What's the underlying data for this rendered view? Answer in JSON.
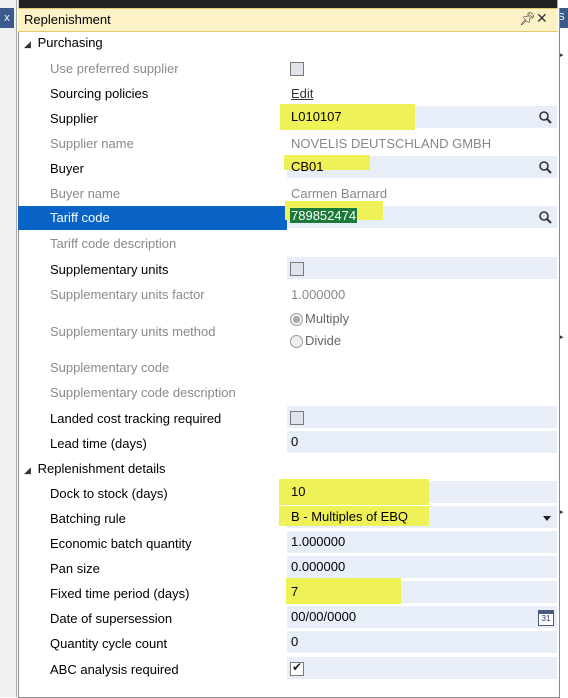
{
  "panel": {
    "title": "Replenishment",
    "pin_icon": "pin-icon",
    "close_icon": "close-icon"
  },
  "left_tab": "x",
  "right_tab": "S",
  "sections": {
    "purchasing": "Purchasing",
    "replenishment_details": "Replenishment details"
  },
  "fields": {
    "use_preferred_supplier": {
      "label": "Use preferred supplier",
      "checked": false
    },
    "sourcing_policies": {
      "label": "Sourcing policies",
      "value": "Edit"
    },
    "supplier": {
      "label": "Supplier",
      "value": "L010107"
    },
    "supplier_name": {
      "label": "Supplier name",
      "value": "NOVELIS DEUTSCHLAND GMBH"
    },
    "buyer": {
      "label": "Buyer",
      "value": "CB01"
    },
    "buyer_name": {
      "label": "Buyer name",
      "value": "Carmen Barnard"
    },
    "tariff_code": {
      "label": "Tariff code",
      "value": "789852474"
    },
    "tariff_code_description": {
      "label": "Tariff code description",
      "value": ""
    },
    "supplementary_units": {
      "label": "Supplementary units",
      "checked": false
    },
    "supplementary_units_factor": {
      "label": "Supplementary units factor",
      "value": "1.000000"
    },
    "supplementary_units_method": {
      "label": "Supplementary units method",
      "options": [
        "Multiply",
        "Divide"
      ],
      "selected": "Multiply"
    },
    "supplementary_code": {
      "label": "Supplementary code",
      "value": ""
    },
    "supplementary_code_description": {
      "label": "Supplementary code description",
      "value": ""
    },
    "landed_cost_tracking_required": {
      "label": "Landed cost tracking required",
      "checked": false
    },
    "lead_time": {
      "label": "Lead time (days)",
      "value": "0"
    },
    "dock_to_stock": {
      "label": "Dock to stock (days)",
      "value": "10"
    },
    "batching_rule": {
      "label": "Batching rule",
      "value": "B - Multiples of EBQ"
    },
    "economic_batch_quantity": {
      "label": "Economic batch quantity",
      "value": "1.000000"
    },
    "pan_size": {
      "label": "Pan size",
      "value": "0.000000"
    },
    "fixed_time_period": {
      "label": "Fixed time period (days)",
      "value": "7"
    },
    "date_of_supersession": {
      "label": "Date of supersession",
      "value": "00/00/0000",
      "calendar_text": "31"
    },
    "quantity_cycle_count": {
      "label": "Quantity cycle count",
      "value": "0"
    },
    "abc_analysis_required": {
      "label": "ABC analysis required",
      "checked": true
    }
  },
  "colors": {
    "title_bar": "#fdf2c6",
    "selected_row": "#0a64c8",
    "highlight": "#eef256",
    "field_bg": "#e8eef7"
  }
}
